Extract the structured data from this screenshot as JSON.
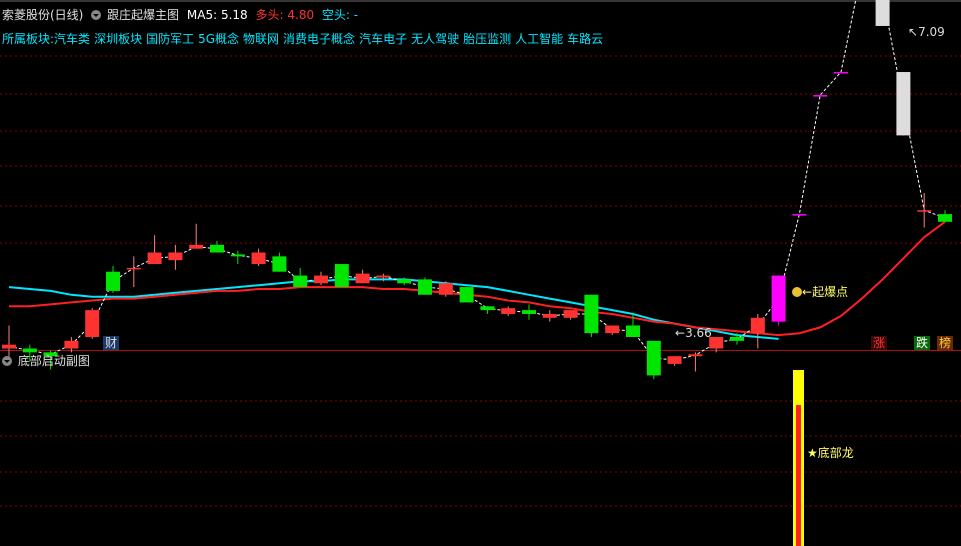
{
  "main_panel": {
    "stock_name": "索菱股份(日线)",
    "indicator_name": "跟庄起爆主图",
    "ma5_label": "MA5:",
    "ma5_value": "5.18",
    "bull_label": "多头:",
    "bull_value": "4.80",
    "bear_label": "空头:",
    "bear_value": "-",
    "sectors_label": "所属板块:",
    "sectors": [
      "汽车类",
      "深圳板块",
      "国防军工",
      "5G概念",
      "物联网",
      "消费电子概念",
      "汽车电子",
      "无人驾驶",
      "胎压监测",
      "人工智能",
      "车路云"
    ],
    "high_marker": "7.09",
    "low_marker": "3.66",
    "signal_label": "起爆点",
    "bottom_tags": {
      "cai": "财",
      "zhang": "涨",
      "die": "跌",
      "bang": "榜"
    }
  },
  "sub_panel": {
    "indicator_name": "底部启动副图",
    "signal_label": "★底部龙"
  },
  "colors": {
    "up": "#ff3232",
    "down": "#00e600",
    "cyan_line": "#00e8ff",
    "red_line": "#ff2020",
    "magenta": "#ff00ff",
    "yellow": "#ffff00",
    "grid": "#8b0000"
  },
  "chart_data": {
    "type": "candlestick",
    "candles": [
      {
        "o": 4.21,
        "c": 4.19,
        "h": 4.31,
        "l": 4.13,
        "up": true
      },
      {
        "o": 4.19,
        "c": 4.17,
        "h": 4.21,
        "l": 4.12,
        "up": false
      },
      {
        "o": 4.15,
        "c": 4.17,
        "h": 4.18,
        "l": 4.08,
        "up": false
      },
      {
        "o": 4.19,
        "c": 4.23,
        "h": 4.25,
        "l": 4.17,
        "up": true
      },
      {
        "o": 4.25,
        "c": 4.39,
        "h": 4.4,
        "l": 4.24,
        "up": true
      },
      {
        "o": 4.49,
        "c": 4.59,
        "h": 4.62,
        "l": 4.48,
        "up": false
      },
      {
        "o": 4.61,
        "c": 4.61,
        "h": 4.67,
        "l": 4.51,
        "up": true
      },
      {
        "o": 4.63,
        "c": 4.69,
        "h": 4.78,
        "l": 4.63,
        "up": true
      },
      {
        "o": 4.65,
        "c": 4.69,
        "h": 4.73,
        "l": 4.6,
        "up": true
      },
      {
        "o": 4.71,
        "c": 4.73,
        "h": 4.84,
        "l": 4.71,
        "up": true
      },
      {
        "o": 4.73,
        "c": 4.69,
        "h": 4.75,
        "l": 4.69,
        "up": false
      },
      {
        "o": 4.68,
        "c": 4.67,
        "h": 4.7,
        "l": 4.63,
        "up": false
      },
      {
        "o": 4.63,
        "c": 4.69,
        "h": 4.71,
        "l": 4.62,
        "up": true
      },
      {
        "o": 4.67,
        "c": 4.59,
        "h": 4.69,
        "l": 4.59,
        "up": false
      },
      {
        "o": 4.57,
        "c": 4.51,
        "h": 4.61,
        "l": 4.51,
        "up": false
      },
      {
        "o": 4.53,
        "c": 4.57,
        "h": 4.59,
        "l": 4.52,
        "up": true
      },
      {
        "o": 4.63,
        "c": 4.51,
        "h": 4.63,
        "l": 4.51,
        "up": false
      },
      {
        "o": 4.53,
        "c": 4.58,
        "h": 4.6,
        "l": 4.53,
        "up": true
      },
      {
        "o": 4.57,
        "c": 4.56,
        "h": 4.58,
        "l": 4.54,
        "up": true
      },
      {
        "o": 4.55,
        "c": 4.53,
        "h": 4.56,
        "l": 4.52,
        "up": false
      },
      {
        "o": 4.55,
        "c": 4.47,
        "h": 4.56,
        "l": 4.47,
        "up": false
      },
      {
        "o": 4.53,
        "c": 4.47,
        "h": 4.54,
        "l": 4.46,
        "up": true
      },
      {
        "o": 4.51,
        "c": 4.43,
        "h": 4.51,
        "l": 4.43,
        "up": false
      },
      {
        "o": 4.41,
        "c": 4.39,
        "h": 4.41,
        "l": 4.37,
        "up": false
      },
      {
        "o": 4.4,
        "c": 4.37,
        "h": 4.41,
        "l": 4.36,
        "up": true
      },
      {
        "o": 4.39,
        "c": 4.37,
        "h": 4.42,
        "l": 4.34,
        "up": false
      },
      {
        "o": 4.37,
        "c": 4.35,
        "h": 4.39,
        "l": 4.33,
        "up": true
      },
      {
        "o": 4.39,
        "c": 4.35,
        "h": 4.39,
        "l": 4.34,
        "up": true
      },
      {
        "o": 4.47,
        "c": 4.27,
        "h": 4.47,
        "l": 4.25,
        "up": false
      },
      {
        "o": 4.31,
        "c": 4.27,
        "h": 4.31,
        "l": 4.26,
        "up": true
      },
      {
        "o": 4.31,
        "c": 4.25,
        "h": 4.37,
        "l": 4.25,
        "up": false
      },
      {
        "o": 4.23,
        "c": 4.05,
        "h": 4.23,
        "l": 4.03,
        "up": false
      },
      {
        "o": 4.11,
        "c": 4.15,
        "h": 4.15,
        "l": 4.1,
        "up": true
      },
      {
        "o": 4.15,
        "c": 4.16,
        "h": 4.17,
        "l": 4.07,
        "up": true
      },
      {
        "o": 4.19,
        "c": 4.25,
        "h": 4.25,
        "l": 4.17,
        "up": true
      },
      {
        "o": 4.25,
        "c": 4.23,
        "h": 4.27,
        "l": 4.21,
        "up": false
      },
      {
        "o": 4.35,
        "c": 4.27,
        "h": 4.37,
        "l": 4.19,
        "up": true
      },
      {
        "o": 4.33,
        "c": 4.57,
        "h": 4.57,
        "l": 4.31,
        "up": true,
        "magenta": true
      },
      {
        "o": 4.89,
        "c": 4.89,
        "h": 4.89,
        "l": 4.89,
        "up": true,
        "magenta": true
      },
      {
        "o": 5.51,
        "c": 5.51,
        "h": 5.51,
        "l": 5.51,
        "up": true,
        "magenta": true
      },
      {
        "o": 5.63,
        "c": 5.63,
        "h": 5.63,
        "l": 5.63,
        "up": true,
        "magenta": true
      },
      {
        "o": 6.16,
        "c": 6.16,
        "h": 6.47,
        "l": 6.16,
        "up": true,
        "magenta": true
      },
      {
        "o": 6.2,
        "c": 5.87,
        "h": 7.09,
        "l": 5.87,
        "up": false,
        "white": true
      },
      {
        "o": 5.63,
        "c": 5.3,
        "h": 5.63,
        "l": 5.3,
        "up": false,
        "white": true
      },
      {
        "o": 4.91,
        "c": 4.91,
        "h": 5.0,
        "l": 4.82,
        "up": true
      },
      {
        "o": 4.89,
        "c": 4.85,
        "h": 4.91,
        "l": 4.85,
        "up": false
      }
    ],
    "ma_cyan": [
      4.51,
      4.5,
      4.49,
      4.47,
      4.46,
      4.46,
      4.46,
      4.47,
      4.48,
      4.49,
      4.5,
      4.51,
      4.52,
      4.53,
      4.54,
      4.54,
      4.55,
      4.55,
      4.55,
      4.55,
      4.54,
      4.53,
      4.52,
      4.51,
      4.49,
      4.47,
      4.45,
      4.43,
      4.41,
      4.39,
      4.37,
      4.34,
      4.32,
      4.3,
      4.28,
      4.26,
      4.25,
      4.24
    ],
    "ma_red": [
      4.41,
      4.41,
      4.42,
      4.43,
      4.44,
      4.45,
      4.45,
      4.46,
      4.47,
      4.48,
      4.49,
      4.49,
      4.5,
      4.5,
      4.51,
      4.51,
      4.51,
      4.51,
      4.5,
      4.5,
      4.49,
      4.48,
      4.47,
      4.46,
      4.44,
      4.43,
      4.41,
      4.4,
      4.38,
      4.37,
      4.35,
      4.33,
      4.32,
      4.3,
      4.29,
      4.28,
      4.27,
      4.26,
      4.27,
      4.3,
      4.36,
      4.45,
      4.55,
      4.66,
      4.77,
      4.85
    ]
  }
}
